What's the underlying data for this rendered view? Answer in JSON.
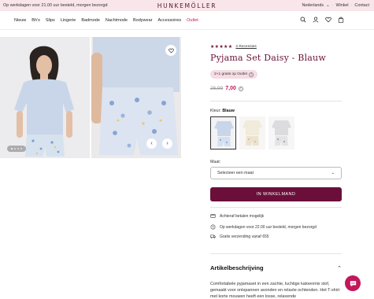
{
  "topbar": {
    "promo": "Op werkdagen voor 21.00 uur besteld, morgen bezorgd",
    "logo": "HUNKEMÖLLER",
    "country": "Nederlands",
    "store_link": "Winkel",
    "contact_link": "Contact"
  },
  "nav": {
    "links": [
      "Nieuw",
      "Bh's",
      "Slips",
      "Lingerie",
      "Badmode",
      "Nachtmode",
      "Bodywear",
      "Accessoires",
      "Outlet"
    ],
    "icons": [
      "search-icon",
      "account-icon",
      "heart-icon",
      "bag-icon"
    ]
  },
  "gallery": {
    "favorite_icon": "heart-icon",
    "prev_label": "‹",
    "next_label": "›"
  },
  "product": {
    "stars": "★★★★★",
    "reviews": "2 Recensies",
    "title": "Pyjama Set Daisy - Blauw",
    "badge": "2+1 gratis op Outlet",
    "old_price": "26,99",
    "new_price": "7,00",
    "color_label": "Kleur:",
    "color_value": "Blauw",
    "size_label": "Maat:",
    "size_placeholder": "Selecteer een maat",
    "cta": "IN WINKELMAND"
  },
  "usps": [
    {
      "icon": "card-icon",
      "text": "Achteraf betalen mogelijk"
    },
    {
      "icon": "clock-icon",
      "text": "Op werkdagen voor 22.00 uur besteld, morgen bezorgd"
    },
    {
      "icon": "truck-icon",
      "text": "Gratis verzending vanaf €65"
    }
  ],
  "description": {
    "heading": "Artikelbeschrijving",
    "text": "Comfortabele pyjamaset in een zachte, luchtige katoenmix stof, gemaakt voor ontspannen avonden en relaxte ochtenden. Het T-shirt met korte mouwen heeft een losse, relaxende"
  },
  "colors": {
    "brand": "#6b0f3a",
    "accent": "#c2185b",
    "promo_bg": "#f8e6ea"
  }
}
